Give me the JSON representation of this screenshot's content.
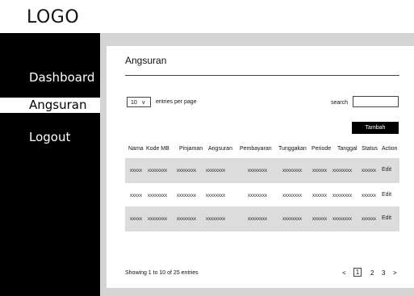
{
  "logo": "LOGO",
  "sidebar": {
    "items": [
      {
        "label": "Dashboard"
      },
      {
        "label": "Angsuran"
      },
      {
        "label": "Logout"
      }
    ]
  },
  "page": {
    "title": "Angsuran",
    "entries_value": "10",
    "entries_label": "entries per page",
    "search_label": "search",
    "search_value": "",
    "add_button": "Tambah"
  },
  "table": {
    "headers": [
      "Nama",
      "Kode MB",
      "Pinjaman",
      "Angsuran",
      "Pembayaran",
      "Tunggakan",
      "Periode",
      "Tanggal",
      "Status",
      "Action"
    ],
    "rows": [
      [
        "xxxxx",
        "xxxxxxxx",
        "xxxxxxxx",
        "xxxxxxxx",
        "xxxxxxxx",
        "xxxxxxxx",
        "xxxxxx",
        "xxxxxxxx",
        "xxxxxx",
        "Edit"
      ],
      [
        "xxxxx",
        "xxxxxxxx",
        "xxxxxxxx",
        "xxxxxxxx",
        "xxxxxxxx",
        "xxxxxxxx",
        "xxxxxx",
        "xxxxxxxx",
        "xxxxxx",
        "Edit"
      ],
      [
        "xxxxx",
        "xxxxxxxx",
        "xxxxxxxx",
        "xxxxxxxx",
        "xxxxxxxx",
        "xxxxxxxx",
        "xxxxxx",
        "xxxxxxxx",
        "xxxxxx",
        "Edit"
      ]
    ]
  },
  "footer": {
    "info": "Showing 1 to 10 of 25 entries",
    "prev": "<",
    "pages": [
      "1",
      "2",
      "3"
    ],
    "next": ">",
    "current_page": "1"
  }
}
